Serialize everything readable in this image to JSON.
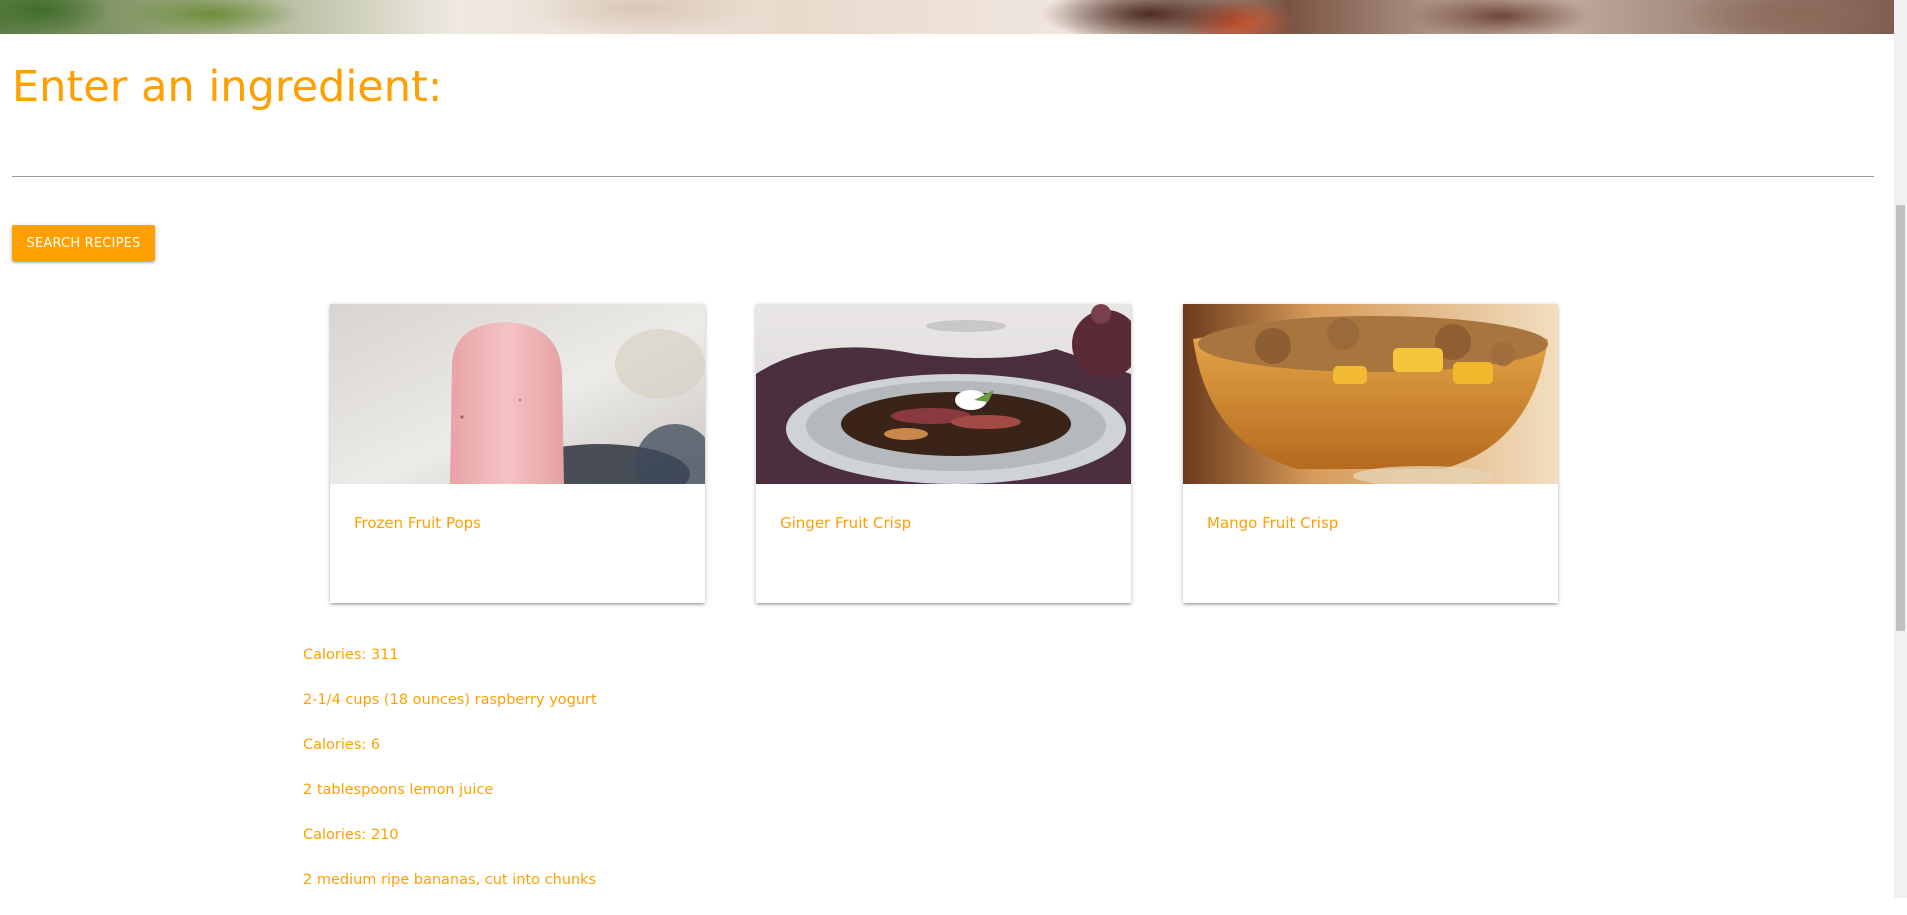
{
  "header": {
    "prompt": "Enter an ingredient:"
  },
  "search": {
    "value": "",
    "placeholder": "",
    "button_label": "SEARCH RECIPES"
  },
  "recipes": [
    {
      "title": "Frozen Fruit Pops",
      "image": "raspberry-yogurt-popsicle"
    },
    {
      "title": "Ginger Fruit Crisp",
      "image": "ginger-plum-crisp"
    },
    {
      "title": "Mango Fruit Crisp",
      "image": "mango-crisp-dessert"
    }
  ],
  "details": [
    "Calories: 311",
    "2-1/4 cups (18 ounces) raspberry yogurt",
    "Calories: 6",
    "2 tablespoons lemon juice",
    "Calories: 210",
    "2 medium ripe bananas, cut into chunks"
  ],
  "colors": {
    "accent": "#FFA000",
    "divider": "#9e9e9e"
  }
}
